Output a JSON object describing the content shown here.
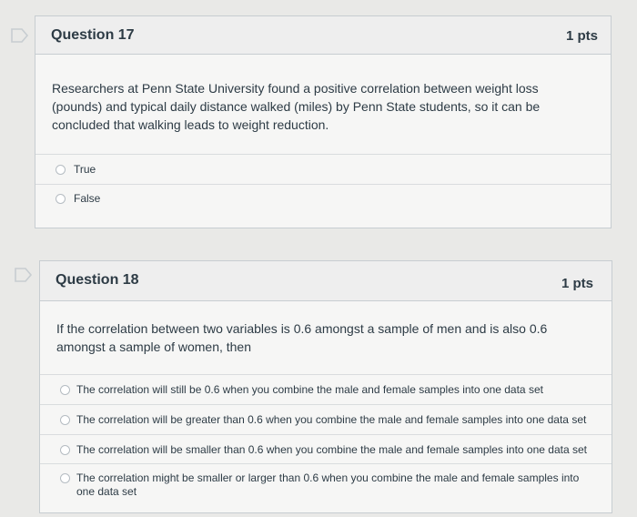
{
  "questions": [
    {
      "title": "Question 17",
      "points": "1 pts",
      "text": "Researchers at Penn State University found a positive correlation between weight loss (pounds) and typical daily distance walked (miles) by Penn State students, so it can be concluded that walking leads to weight reduction.",
      "answers": [
        "True",
        "False"
      ]
    },
    {
      "title": "Question 18",
      "points": "1 pts",
      "text": "If the correlation between two variables is 0.6 amongst a sample of men and is also 0.6 amongst a sample of women, then",
      "answers": [
        "The correlation will still be 0.6 when you combine the male and female samples into one data set",
        "The correlation will be greater than 0.6 when you combine the male and female samples into one data set",
        "The correlation will be smaller than 0.6 when you combine the male and female samples into one data set",
        "The correlation might be smaller or larger than 0.6 when you combine the male and female samples into one data set"
      ]
    }
  ],
  "colors": {
    "flag_outline": "#c7cdd1",
    "border": "#c7cdd1",
    "text": "#2d3b45"
  },
  "icons": {
    "flag": "flag-icon",
    "radio": "radio-button"
  }
}
